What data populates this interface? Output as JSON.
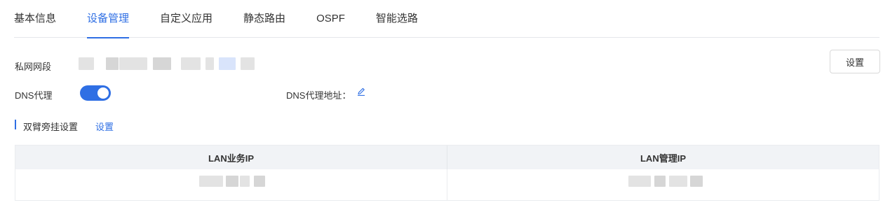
{
  "tabs": [
    {
      "label": "基本信息",
      "active": false
    },
    {
      "label": "设备管理",
      "active": true
    },
    {
      "label": "自定义应用",
      "active": false
    },
    {
      "label": "静态路由",
      "active": false
    },
    {
      "label": "OSPF",
      "active": false
    },
    {
      "label": "智能选路",
      "active": false
    }
  ],
  "private_segment": {
    "label": "私网网段"
  },
  "setting_button": {
    "label": "设置"
  },
  "dns_proxy": {
    "label": "DNS代理",
    "enabled": true,
    "address_label": "DNS代理地址：",
    "edit_icon": "pencil-icon"
  },
  "dual_arm": {
    "title": "双臂旁挂设置",
    "link": "设置"
  },
  "table": {
    "columns": [
      "LAN业务IP",
      "LAN管理IP"
    ]
  },
  "colors": {
    "accent": "#2f6fe4",
    "border": "#e5e7eb",
    "header_bg": "#f1f3f6"
  }
}
